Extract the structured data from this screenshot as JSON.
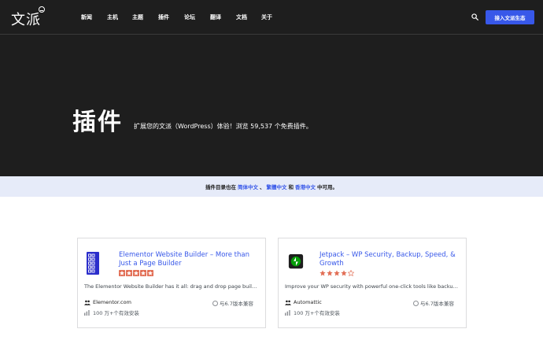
{
  "header": {
    "logo_text": "文派",
    "logo_mark": "wordpress-icon",
    "nav": [
      "新闻",
      "主机",
      "主题",
      "插件",
      "论坛",
      "翻译",
      "文档",
      "关于"
    ],
    "search_icon": "search-icon",
    "cta_label": "接入文派生态"
  },
  "hero": {
    "title": "插件",
    "description": "扩展您的文派（WordPress）体验！浏览 59,537 个免费插件。"
  },
  "notice": {
    "prefix": "插件目录也在",
    "link1": "简体中文",
    "sep1": "、",
    "link2": "繁體中文",
    "and": "和",
    "link3": "香港中文",
    "suffix": "中可用。"
  },
  "plugins": [
    {
      "name": "Elementor Website Builder – More than Just a Page Builder",
      "rating": 5,
      "excerpt": "The Elementor Website Builder has it all: drag and drop page buil…",
      "author": "Elementor.com",
      "compat": "与6.7版本兼容",
      "installs": "100 万+个有效安装",
      "icon": "elementor-icon",
      "icon_color": "#2b2ecb"
    },
    {
      "name": "Jetpack – WP Security, Backup, Speed, & Growth",
      "rating": 4,
      "excerpt": "Improve your WP security with powerful one-click tools like backu…",
      "author": "Automattic",
      "compat": "与6.7版本兼容",
      "installs": "100 万+个有效安装",
      "icon": "jetpack-icon",
      "icon_color": "#069e08"
    }
  ],
  "colors": {
    "dark_bg": "#1e1e1e",
    "accent": "#3858e9",
    "notice_bg": "#e6ebf9",
    "star": "#e26f56"
  }
}
